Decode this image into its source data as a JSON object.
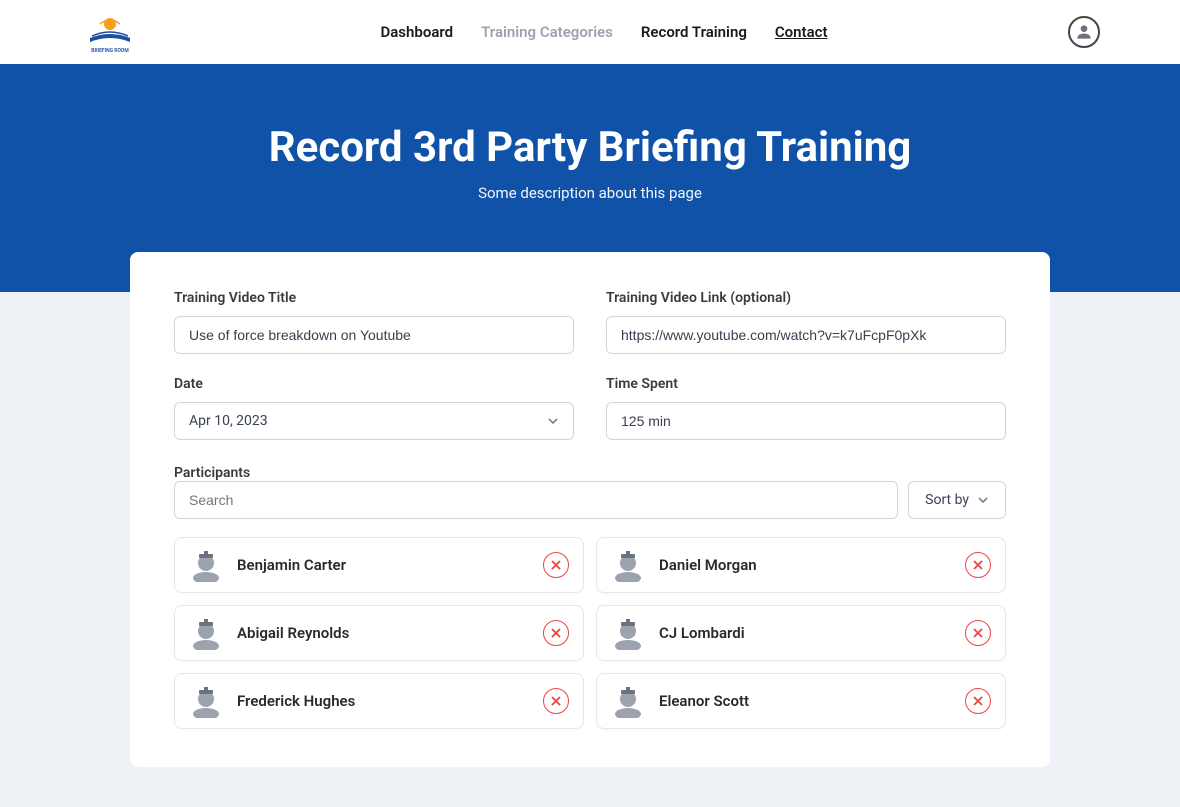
{
  "brand": {
    "name": "The Briefing Room"
  },
  "nav": {
    "items": [
      {
        "label": "Dashboard",
        "muted": false,
        "underline": false
      },
      {
        "label": "Training Categories",
        "muted": true,
        "underline": false
      },
      {
        "label": "Record Training",
        "muted": false,
        "underline": false
      },
      {
        "label": "Contact",
        "muted": false,
        "underline": true
      }
    ]
  },
  "hero": {
    "title": "Record 3rd Party Briefing Training",
    "subtitle": "Some description about this page"
  },
  "form": {
    "title_label": "Training Video Title",
    "title_value": "Use of force breakdown on Youtube",
    "link_label": "Training Video Link (optional)",
    "link_value": "https://www.youtube.com/watch?v=k7uFcpF0pXk",
    "date_label": "Date",
    "date_value": "Apr 10, 2023",
    "time_label": "Time Spent",
    "time_value": "125 min",
    "participants_label": "Participants",
    "search_placeholder": "Search",
    "sort_label": "Sort by"
  },
  "participants": [
    {
      "name": "Benjamin Carter"
    },
    {
      "name": "Daniel Morgan"
    },
    {
      "name": "Abigail Reynolds"
    },
    {
      "name": "CJ Lombardi"
    },
    {
      "name": "Frederick Hughes"
    },
    {
      "name": "Eleanor Scott"
    }
  ]
}
